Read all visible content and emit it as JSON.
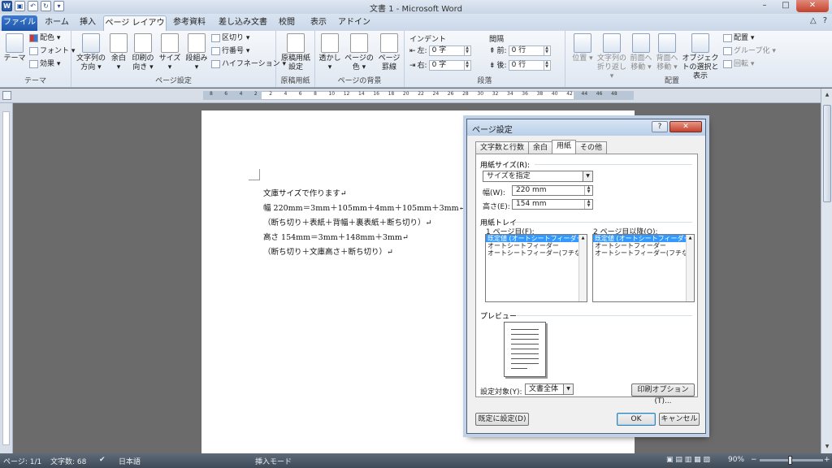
{
  "window": {
    "title": "文書 1 - Microsoft Word",
    "minimize_glyph": "–",
    "maximize_glyph": "□",
    "close_glyph": "✕",
    "help_glyph": "?",
    "ribbon_min_glyph": "△"
  },
  "qat": {
    "word_icon": "W",
    "save_icon": "▣",
    "undo_icon": "↶",
    "redo_icon": "↻",
    "more_icon": "▾"
  },
  "tabs": [
    "ファイル",
    "ホーム",
    "挿入",
    "ページ レイアウト",
    "参考資料",
    "差し込み文書",
    "校閲",
    "表示",
    "アドイン"
  ],
  "active_tab": "ページ レイアウト",
  "ribbon": {
    "theme": {
      "big_label": "テーマ",
      "colors": "配色 ▾",
      "fonts": "フォント ▾",
      "effects": "効果 ▾",
      "group": "テーマ"
    },
    "page_setup": {
      "text_direction": "文字列の方向 ▾",
      "margins": "余白 ▾",
      "orientation": "印刷の向き ▾",
      "size": "サイズ ▾",
      "columns": "段組み ▾",
      "breaks": "区切り ▾",
      "line_numbers": "行番号 ▾",
      "hyphenation": "ハイフネーション ▾",
      "group": "ページ設定"
    },
    "manuscript": {
      "label": "原稿用紙設定",
      "group": "原稿用紙"
    },
    "background": {
      "watermark": "透かし ▾",
      "page_color": "ページの色 ▾",
      "page_borders": "ページ罫線",
      "group": "ページの背景"
    },
    "paragraph": {
      "indent_label": "インデント",
      "left": "左:",
      "left_value": "0 字",
      "right": "右:",
      "right_value": "0 字",
      "spacing_label": "間隔",
      "before": "前:",
      "before_value": "0 行",
      "after": "後:",
      "after_value": "0 行",
      "group": "段落"
    },
    "arrange": {
      "position": "位置 ▾",
      "wrap": "文字列の折り返し ▾",
      "bring_forward": "前面へ移動 ▾",
      "send_backward": "背面へ移動 ▾",
      "selection_pane": "オブジェクトの選択と表示",
      "align": "配置 ▾",
      "group_btn": "グループ化 ▾",
      "rotate": "回転 ▾",
      "group": "配置"
    }
  },
  "ruler_ticks": [
    "8",
    "6",
    "4",
    "2",
    "2",
    "4",
    "6",
    "8",
    "10",
    "12",
    "14",
    "16",
    "18",
    "20",
    "22",
    "24",
    "26",
    "28",
    "30",
    "32",
    "34",
    "36",
    "38",
    "40",
    "42",
    "44",
    "46",
    "48"
  ],
  "document": {
    "lines": [
      "文庫サイズで作ります↵",
      "幅 220mm＝3mm＋105mm＋4mm＋105mm＋3mm↵",
      "（断ち切り＋表紙＋背幅＋裏表紙＋断ち切り）↵",
      "高さ 154mm＝3mm＋148mm＋3mm↵",
      "（断ち切り＋文庫高さ＋断ち切り）↵"
    ]
  },
  "status": {
    "page": "ページ: 1/1",
    "words": "文字数: 68",
    "language": "日本語",
    "mode": "挿入モード",
    "zoom": "90%",
    "zoom_minus": "−",
    "zoom_plus": "+"
  },
  "dialog": {
    "title": "ページ設定",
    "tabs": [
      "文字数と行数",
      "余白",
      "用紙",
      "その他"
    ],
    "active_tab": "用紙",
    "paper_size_label": "用紙サイズ(R):",
    "paper_size_value": "サイズを指定",
    "width_label": "幅(W):",
    "width_value": "220 mm",
    "height_label": "高さ(E):",
    "height_value": "154 mm",
    "tray_label": "用紙トレイ",
    "first_page_label": "1 ページ目(F):",
    "other_pages_label": "2 ページ目以降(O):",
    "tray_items": [
      "既定値 (オートシートフィーダー)",
      "オートシートフィーダー",
      "オートシートフィーダー(フチなし)"
    ],
    "preview_label": "プレビュー",
    "apply_to_label": "設定対象(Y):",
    "apply_to_value": "文書全体",
    "print_options": "印刷オプション(T)...",
    "set_default": "既定に設定(D)",
    "ok": "OK",
    "cancel": "キャンセル"
  }
}
